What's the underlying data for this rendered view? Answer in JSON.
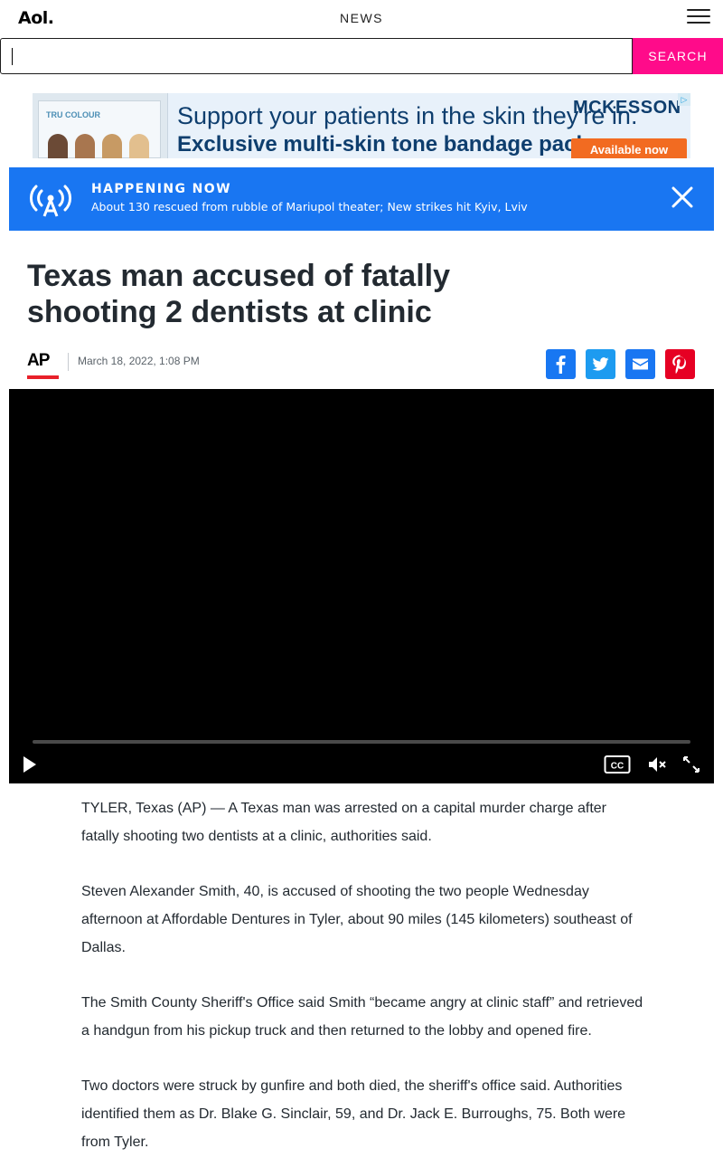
{
  "header": {
    "logo": "Aol.",
    "section": "NEWS"
  },
  "search": {
    "value": "",
    "button_label": "SEARCH"
  },
  "ad": {
    "brand": "TRU COLOUR",
    "headline": "Support your patients in the skin they're in.",
    "subline": "Exclusive multi-skin tone bandage packs.",
    "advertiser": "MCKESSON",
    "cta": "Available now",
    "choices_icon": "ad-choices-icon"
  },
  "breaking": {
    "label": "HAPPENING NOW",
    "text": "About 130 rescued from rubble of Mariupol theater; New strikes hit Kyiv, Lviv",
    "accent": "#1976f2"
  },
  "article": {
    "headline": "Texas man accused of fatally shooting 2 dentists at clinic",
    "source_logo": "AP",
    "date": "March 18, 2022, 1:08 PM",
    "paragraphs": [
      "TYLER, Texas (AP) — A Texas man was arrested on a capital murder charge after fatally shooting two dentists at a clinic, authorities said.",
      "Steven Alexander Smith, 40, is accused of shooting the two people Wednesday afternoon at Affordable Dentures in Tyler, about 90 miles (145 kilometers) southeast of Dallas.",
      "The Smith County Sheriff's Office said Smith “became angry at clinic staff” and retrieved a handgun from his pickup truck and then returned to the lobby and opened fire.",
      "Two doctors were struck by gunfire and both died, the sheriff's office said. Authorities identified them as Dr. Blake G. Sinclair, 59, and Dr. Jack E. Burroughs, 75. Both were from Tyler."
    ]
  },
  "share": {
    "facebook_color": "#1877f2",
    "twitter_color": "#1d9bf0",
    "email_color": "#1976f2",
    "pinterest_color": "#e60023"
  },
  "video": {
    "progress": 0,
    "muted": true,
    "controls": [
      "play-icon",
      "closed-captions-icon",
      "mute-icon",
      "fullscreen-icon"
    ]
  }
}
